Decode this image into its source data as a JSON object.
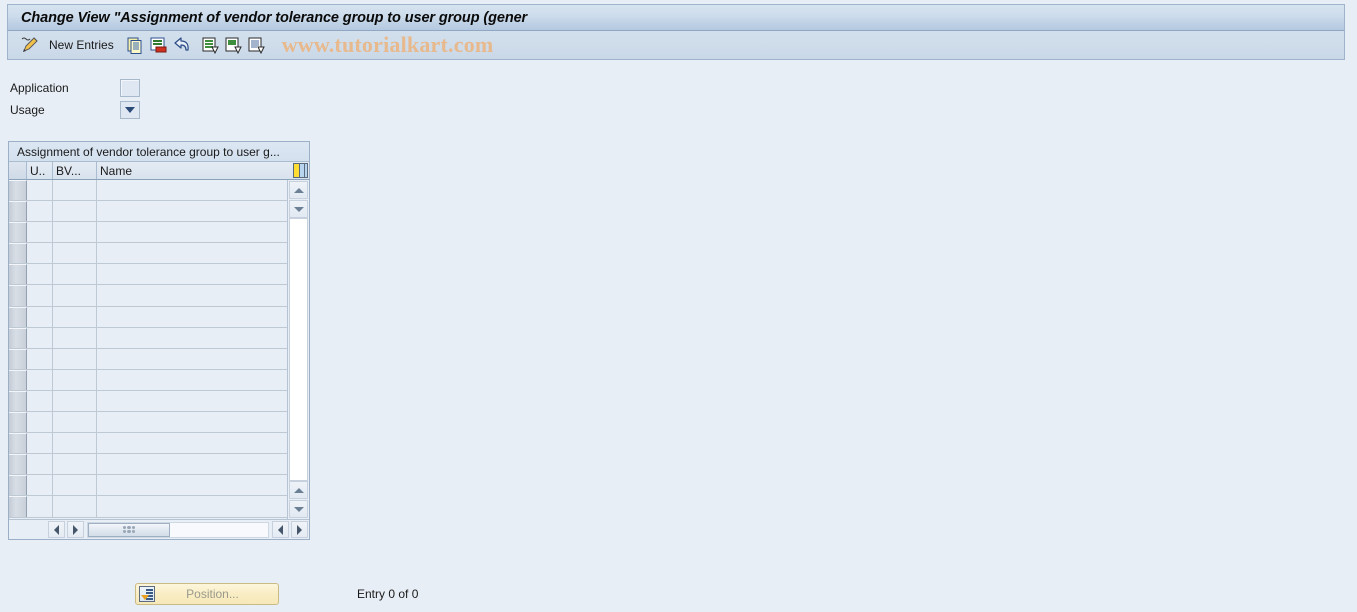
{
  "window": {
    "title": "Change View \"Assignment of vendor tolerance group to user group (gener"
  },
  "toolbar": {
    "display_change_icon": "pencil-display-change-icon",
    "new_entries_label": "New Entries",
    "copy_icon": "copy-as-icon",
    "delete_icon": "delete-icon",
    "undo_icon": "undo-icon",
    "select_all_icon": "select-all-icon",
    "deselect_all_icon": "deselect-all-icon",
    "details_icon": "details-icon",
    "watermark": "www.tutorialkart.com"
  },
  "form": {
    "fields": [
      {
        "label": "Application",
        "value": "",
        "type": "input"
      },
      {
        "label": "Usage",
        "value": "",
        "type": "dropdown"
      }
    ]
  },
  "table": {
    "title": "Assignment of vendor tolerance group to user g...",
    "config_icon": "table-settings-icon",
    "columns": [
      {
        "key": "select",
        "label": ""
      },
      {
        "key": "u",
        "label": "U.."
      },
      {
        "key": "bv",
        "label": "BV..."
      },
      {
        "key": "name",
        "label": "Name"
      }
    ],
    "rows": [
      {
        "u": "",
        "bv": "",
        "name": ""
      },
      {
        "u": "",
        "bv": "",
        "name": ""
      },
      {
        "u": "",
        "bv": "",
        "name": ""
      },
      {
        "u": "",
        "bv": "",
        "name": ""
      },
      {
        "u": "",
        "bv": "",
        "name": ""
      },
      {
        "u": "",
        "bv": "",
        "name": ""
      },
      {
        "u": "",
        "bv": "",
        "name": ""
      },
      {
        "u": "",
        "bv": "",
        "name": ""
      },
      {
        "u": "",
        "bv": "",
        "name": ""
      },
      {
        "u": "",
        "bv": "",
        "name": ""
      },
      {
        "u": "",
        "bv": "",
        "name": ""
      },
      {
        "u": "",
        "bv": "",
        "name": ""
      },
      {
        "u": "",
        "bv": "",
        "name": ""
      },
      {
        "u": "",
        "bv": "",
        "name": ""
      },
      {
        "u": "",
        "bv": "",
        "name": ""
      },
      {
        "u": "",
        "bv": "",
        "name": ""
      }
    ],
    "scroll": {
      "up_icon": "scroll-up-icon",
      "down_icon": "scroll-down-icon",
      "left_icon": "scroll-left-icon",
      "right_icon": "scroll-right-icon"
    }
  },
  "footer": {
    "position_button_label": "Position...",
    "position_button_icon": "position-icon",
    "entry_status": "Entry 0 of 0"
  },
  "colors": {
    "background": "#e8eef6",
    "titlebar_start": "#d6e3f0",
    "titlebar_end": "#b4c9e0",
    "watermark": "#e7b98c",
    "position_button": "#f9edc4"
  }
}
